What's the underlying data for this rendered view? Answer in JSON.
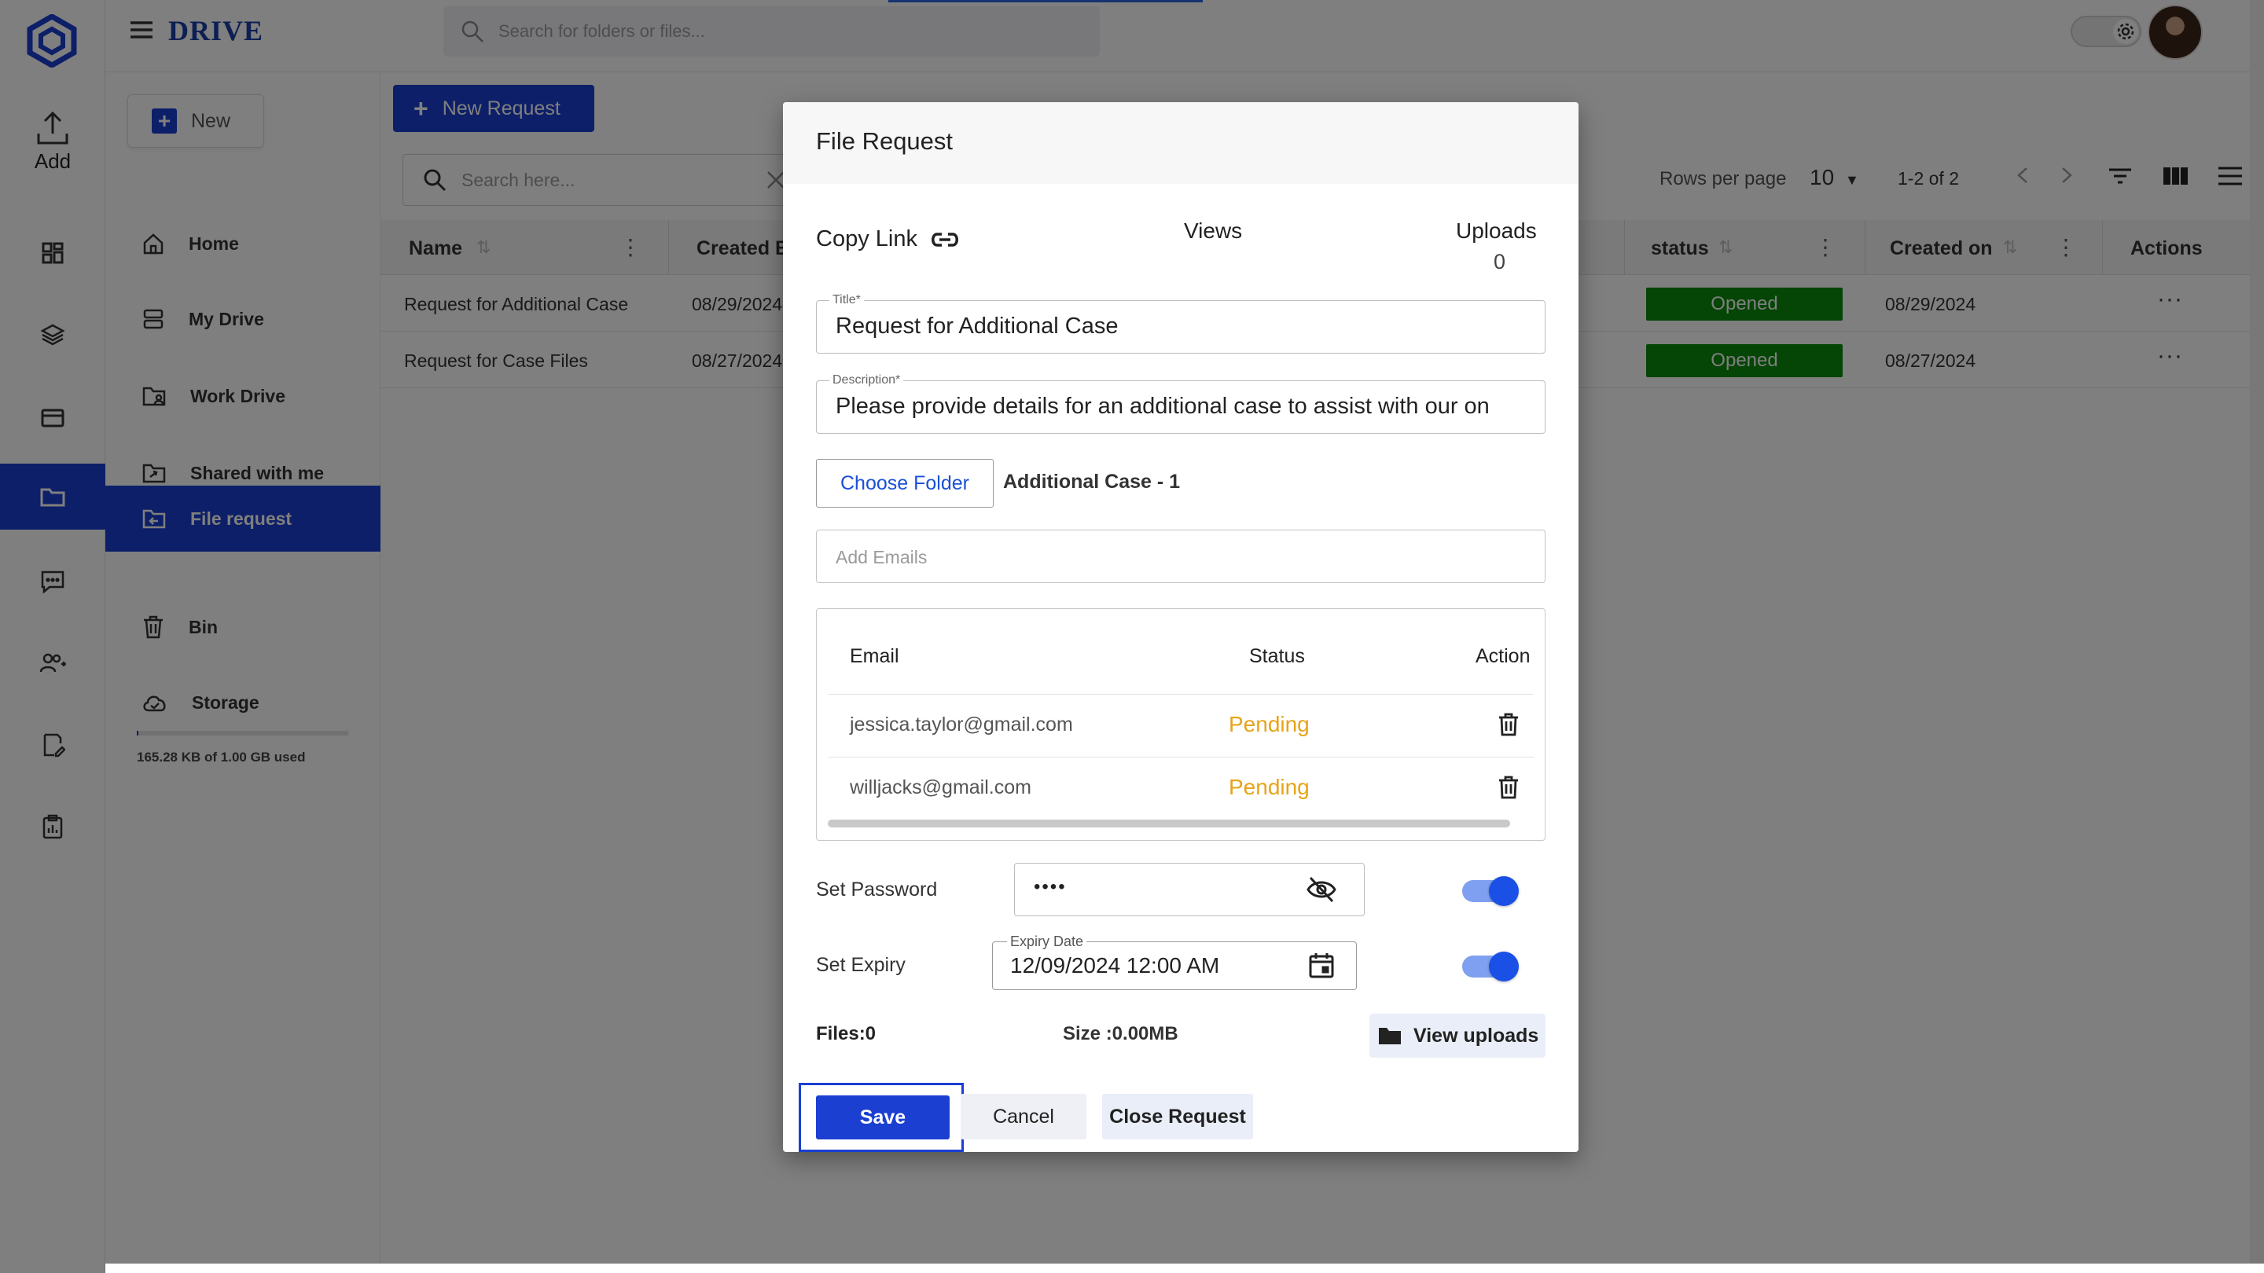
{
  "app": {
    "brand": "DRIVE",
    "search_placeholder": "Search for folders or files..."
  },
  "rail": {
    "add_label": "Add"
  },
  "sidebar": {
    "new_label": "New",
    "items": [
      {
        "label": "Home",
        "icon": "home-icon"
      },
      {
        "label": "My Drive",
        "icon": "drive-icon"
      },
      {
        "label": "Work Drive",
        "icon": "work-drive-icon"
      },
      {
        "label": "Shared with me",
        "icon": "shared-folder-icon"
      },
      {
        "label": "File request",
        "icon": "file-request-icon",
        "active": true
      },
      {
        "label": "Bin",
        "icon": "trash-icon"
      },
      {
        "label": "Storage",
        "icon": "cloud-icon"
      }
    ],
    "storage_text": "165.28 KB of 1.00 GB used"
  },
  "main": {
    "new_request_label": "New Request",
    "search_placeholder": "Search here...",
    "rows_per_page_label": "Rows per page",
    "rows_per_page_value": "10",
    "range_text": "1-2 of 2",
    "columns": [
      "Name",
      "Created B",
      "status",
      "Created on",
      "Actions"
    ],
    "rows": [
      {
        "name": "Request for Additional Case",
        "created_by": "08/29/2024",
        "status": "Opened",
        "created_on": "08/29/2024"
      },
      {
        "name": "Request for Case Files",
        "created_by": "08/27/2024",
        "status": "Opened",
        "created_on": "08/27/2024"
      }
    ],
    "status_color": "#0a8a0a"
  },
  "dialog": {
    "title": "File Request",
    "copy_link_label": "Copy Link",
    "views_label": "Views",
    "uploads_label": "Uploads",
    "uploads_value": "0",
    "title_field_label": "Title*",
    "title_field_value": "Request for Additional Case",
    "description_label": "Description*",
    "description_value": "Please provide details for an additional case to assist with our on",
    "choose_folder_label": "Choose Folder",
    "folder_name": "Additional Case - 1",
    "add_emails_placeholder": "Add Emails",
    "email_table": {
      "headers": {
        "email": "Email",
        "status": "Status",
        "action": "Action"
      },
      "rows": [
        {
          "email": "jessica.taylor@gmail.com",
          "status": "Pending"
        },
        {
          "email": "willjacks@gmail.com",
          "status": "Pending"
        }
      ]
    },
    "set_password_label": "Set Password",
    "password_value": "••••",
    "set_expiry_label": "Set Expiry",
    "expiry_label": "Expiry Date",
    "expiry_value": "12/09/2024 12:00 AM",
    "files_label": "Files:0",
    "size_label": "Size :0.00MB",
    "view_uploads_label": "View uploads",
    "save_label": "Save",
    "cancel_label": "Cancel",
    "close_request_label": "Close Request",
    "accent_color": "#1a3fd1",
    "pending_color": "#e8a317"
  }
}
